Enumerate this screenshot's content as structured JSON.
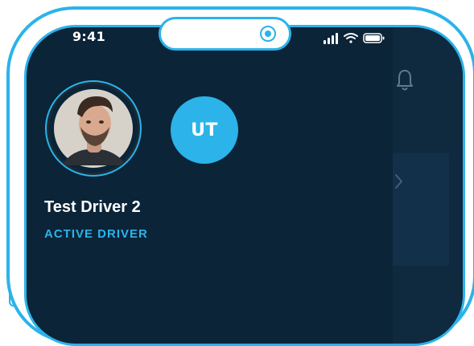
{
  "status_bar": {
    "time": "9:41",
    "icons": [
      "signal-icon",
      "wifi-icon",
      "battery-icon"
    ]
  },
  "profile": {
    "initials": "UT",
    "name": "Test Driver 2",
    "status": "ACTIVE DRIVER"
  },
  "side_panel": {
    "icons": [
      "bell-icon",
      "chevron-right-icon"
    ]
  },
  "colors": {
    "accent": "#2bb3ea",
    "screen_bg": "#0b2438",
    "panel_bg": "#0f2a3f",
    "text": "#ffffff"
  }
}
